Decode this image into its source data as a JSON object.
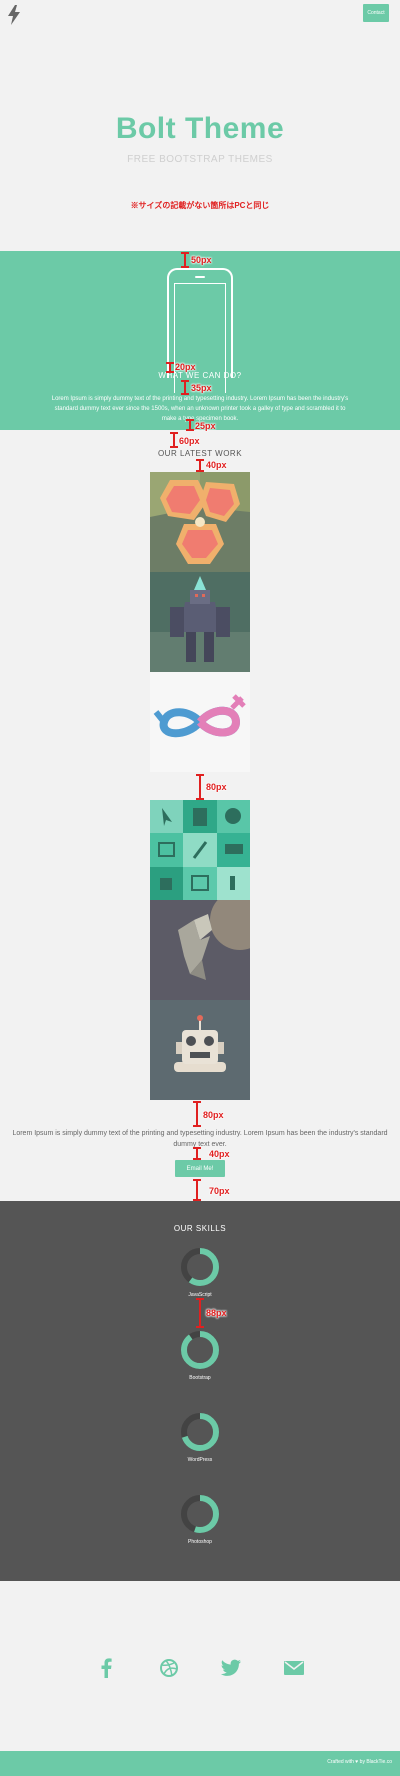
{
  "header": {
    "logo_icon": "bolt-icon",
    "contact_label": "Contact"
  },
  "hero": {
    "title": "Bolt Theme",
    "subtitle": "FREE BOOTSTRAP THEMES",
    "note": "※サイズの記載がない箇所はPCと同じ"
  },
  "what": {
    "heading": "WHAT WE CAN DO?",
    "text": "Lorem Ipsum is simply dummy text of the printing and typesetting industry. Lorem Ipsum has been the industry's standard dummy text ever since the 1500s, when an unknown printer took a galley of type and scrambled it to make a type specimen book."
  },
  "spacing_labels": {
    "s50": "50px",
    "s20": "20px",
    "s35": "35px",
    "s25": "25px",
    "s60": "60px",
    "s40a": "40px",
    "s80a": "80px",
    "s80b": "80px",
    "s40b": "40px",
    "s70": "70px",
    "s88": "88px"
  },
  "work": {
    "heading": "OUR LATEST WORK"
  },
  "about": {
    "text": "Lorem Ipsum is simply dummy text of the printing and typesetting industry. Lorem Ipsum has been the industry's standard dummy text ever.",
    "email_label": "Email Me!"
  },
  "skills": {
    "heading": "OUR SKILLS",
    "items": [
      {
        "label": "JavaScript",
        "percent": 60
      },
      {
        "label": "Bootstrap",
        "percent": 90
      },
      {
        "label": "WordPress",
        "percent": 70
      },
      {
        "label": "Photoshop",
        "percent": 55
      }
    ]
  },
  "social": [
    "facebook-icon",
    "dribbble-icon",
    "twitter-icon",
    "email-icon"
  ],
  "footer": {
    "text": "Crafted with ♥ by BlackTie.co"
  },
  "colors": {
    "accent": "#6ccaa7",
    "dark": "#555555",
    "marker": "#e02020"
  }
}
